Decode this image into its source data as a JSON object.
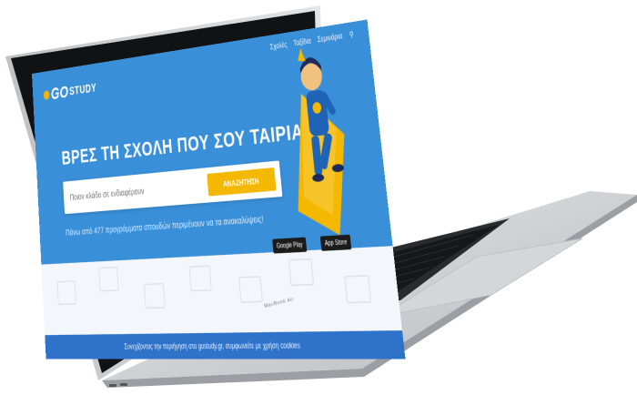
{
  "site": {
    "logo_go": "GO",
    "logo_study": "STUDY",
    "nav": [
      "Σχολές",
      "Ταξίδια",
      "Σεμινάρια"
    ],
    "hero_title": "ΒΡΕΣ ΤΗ ΣΧΟΛΗ ΠΟΥ ΣΟΥ ΤΑΙΡΙΑΖΕΙ",
    "search_placeholder": "Ποιον κλάδο σε ενδιαφέρουν",
    "search_button": "ΑΝΑΖΗΤΗΣΗ",
    "hero_subtitle": "Πάνω από 477 προγράμματα σπουδών περιμένουν να τα ανακαλύψεις!",
    "footer_text": "Συνεχίζοντας την περιήγηση στο gostudy.gr, συμφωνείτε με χρήση cookies",
    "app_badge_1": "Google Play",
    "app_badge_2": "App Store"
  },
  "device": {
    "brand": "MacBook Air",
    "colors": {
      "body": "#c9cbd0",
      "bezel": "#111214",
      "keys": "#1b1c1f",
      "accent": "#3a8fd9"
    }
  }
}
